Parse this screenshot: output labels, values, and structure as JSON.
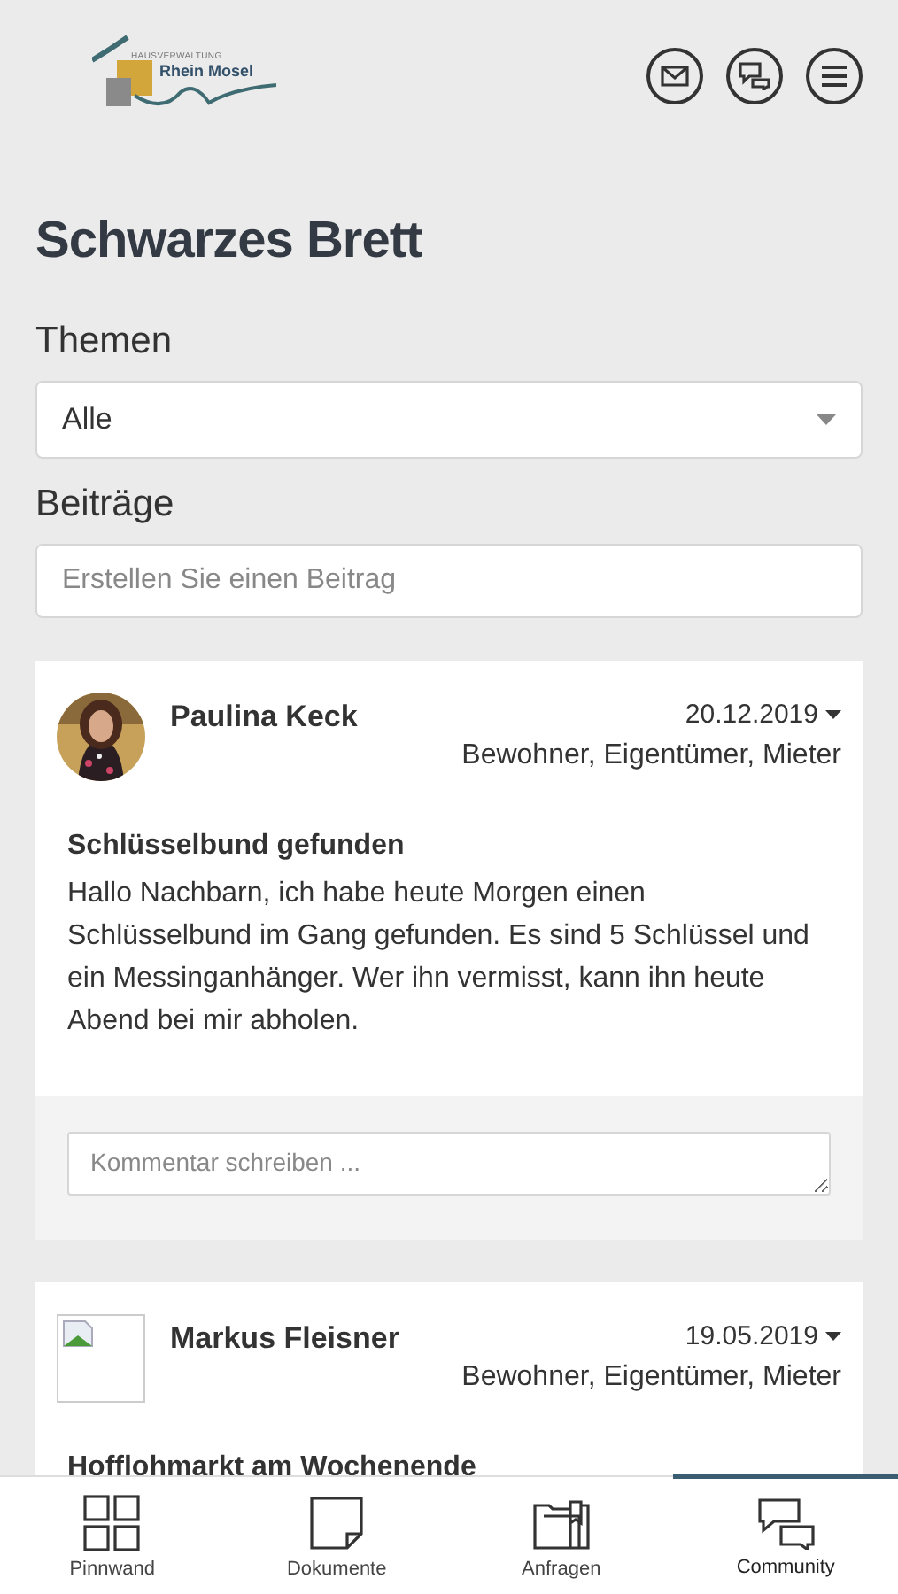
{
  "header": {
    "logo": {
      "small_text": "HAUSVERWALTUNG",
      "name": "Rhein Mosel"
    }
  },
  "page_title": "Schwarzes Brett",
  "topics": {
    "label": "Themen",
    "value": "Alle"
  },
  "posts_section": {
    "label": "Beiträge",
    "placeholder": "Erstellen Sie einen Beitrag"
  },
  "posts": [
    {
      "author": "Paulina Keck",
      "date": "20.12.2019",
      "audience": "Bewohner, Eigentümer, Mieter",
      "title": "Schlüsselbund gefunden",
      "body": "Hallo Nachbarn, ich habe heute Morgen einen Schlüsselbund im Gang gefunden. Es sind 5 Schlüssel und ein Messinganhänger. Wer ihn vermisst, kann ihn heute Abend bei mir abholen.",
      "comment_placeholder": "Kommentar schreiben ..."
    },
    {
      "author": "Markus Fleisner",
      "avatar": {
        "kind": "broken"
      },
      "date": "19.05.2019",
      "audience": "Bewohner, Eigentümer, Mieter",
      "title": "Hofflohmarkt am Wochenende"
    }
  ],
  "nav": [
    {
      "label": "Pinnwand",
      "selected": false
    },
    {
      "label": "Dokumente",
      "selected": false
    },
    {
      "label": "Anfragen",
      "selected": false
    },
    {
      "label": "Community",
      "selected": true
    }
  ]
}
